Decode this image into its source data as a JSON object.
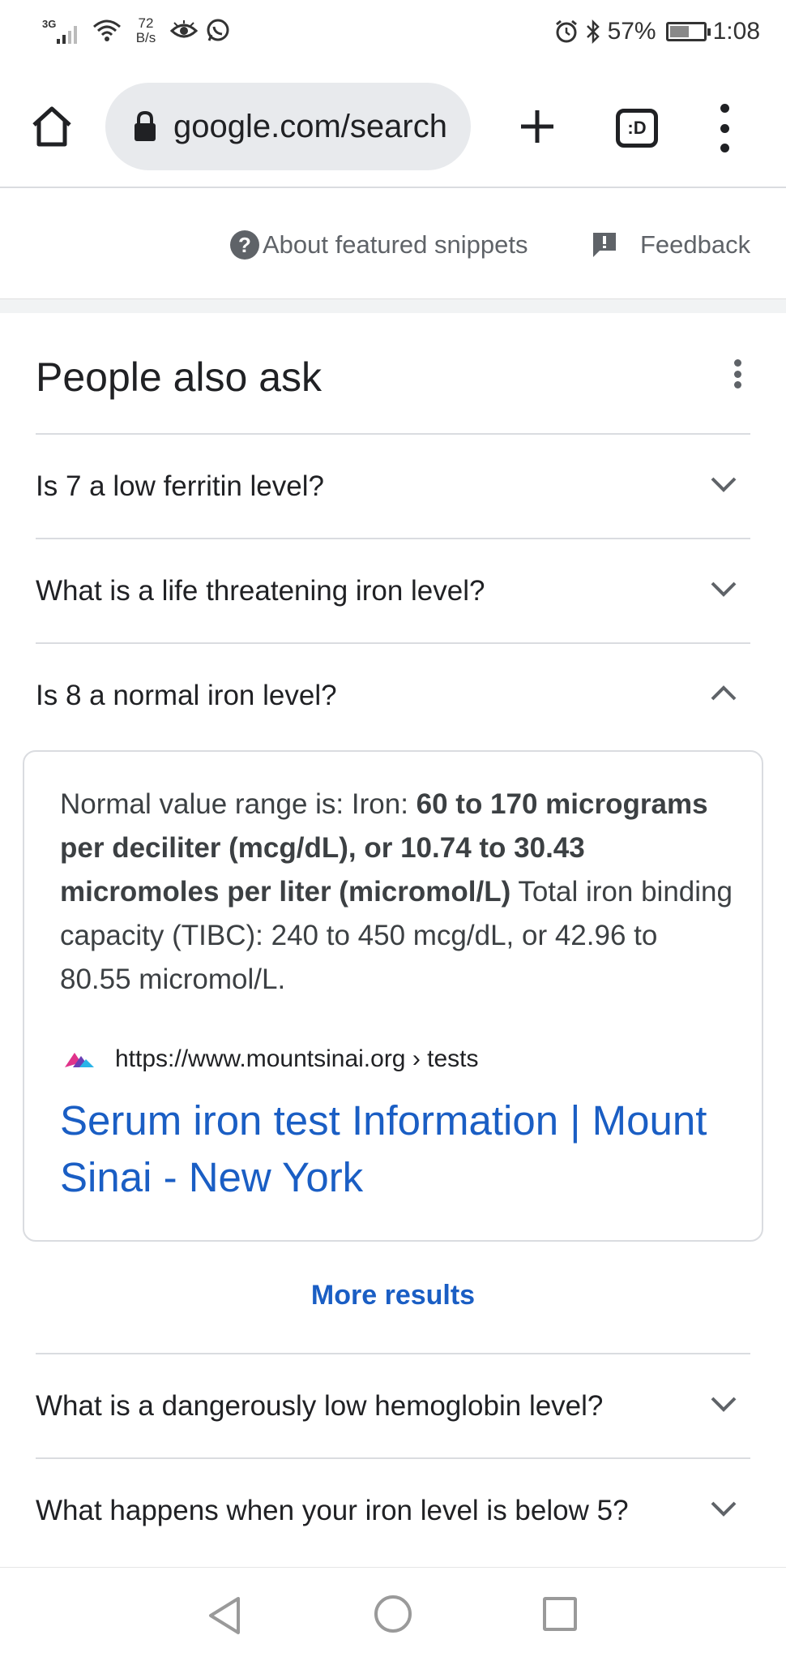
{
  "status_bar": {
    "network": "3G",
    "speed_value": "72",
    "speed_unit": "B/s",
    "battery": "57%",
    "battery_level": 0.57,
    "time": "1:08"
  },
  "browser": {
    "url": "google.com/search"
  },
  "snippet_meta": {
    "about_label": "About featured snippets",
    "feedback_label": "Feedback"
  },
  "paa": {
    "title": "People also ask",
    "questions": [
      "Is 7 a low ferritin level?",
      "What is a life threatening iron level?",
      "Is 8 a normal iron level?",
      "What is a dangerously low hemoglobin level?",
      "What happens when your iron level is below 5?"
    ],
    "answer": {
      "intro": "Normal value range is: Iron: ",
      "bold": "60 to 170 micrograms per deciliter (mcg/dL), or 10.74 to 30.43 micromoles per liter (micromol/L)",
      "rest": " Total iron binding capacity (TIBC): 240 to 450 mcg/dL, or 42.96 to 80.55 micromol/L.",
      "source_url": "https://www.mountsinai.org › tests",
      "link_title": "Serum iron test Information | Mount Sinai - New York"
    },
    "more_results_label": "More results"
  },
  "colors": {
    "link": "#1a5ec4",
    "text": "#202124",
    "muted": "#5f6368",
    "divider": "#dadce0"
  }
}
